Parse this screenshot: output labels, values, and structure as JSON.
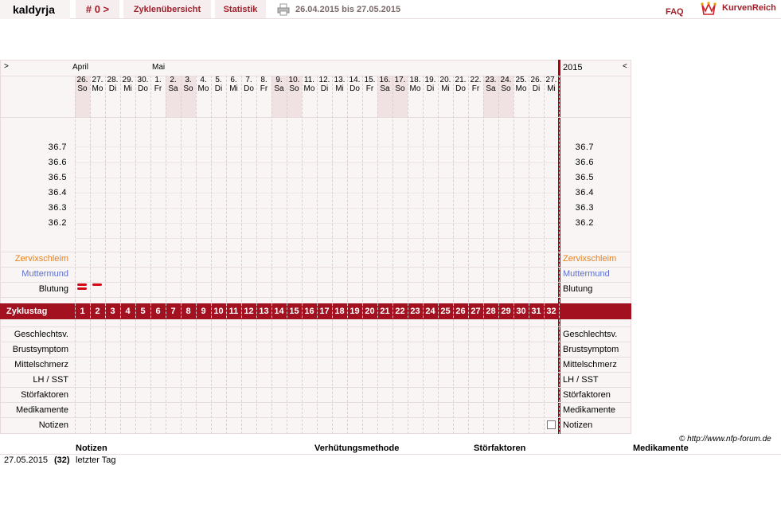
{
  "header": {
    "brand": "kaldyrja",
    "cycle_nav": "# 0 >",
    "tab_overview": "Zyklenübersicht",
    "tab_stats": "Statistik",
    "date_range": "26.04.2015 bis 27.05.2015",
    "faq": "FAQ",
    "logo_text": "KurvenReich",
    "accent": "#a0202a"
  },
  "chart": {
    "nav_left": ">",
    "nav_right": "<",
    "year": "2015",
    "months": [
      "April",
      "Mai"
    ],
    "dates": [
      "26.",
      "27.",
      "28.",
      "29.",
      "30.",
      "1.",
      "2.",
      "3.",
      "4.",
      "5.",
      "6.",
      "7.",
      "8.",
      "9.",
      "10.",
      "11.",
      "12.",
      "13.",
      "14.",
      "15.",
      "16.",
      "17.",
      "18.",
      "19.",
      "20.",
      "21.",
      "22.",
      "23.",
      "24.",
      "25.",
      "26.",
      "27."
    ],
    "weekdays": [
      "So",
      "Mo",
      "Di",
      "Mi",
      "Do",
      "Fr",
      "Sa",
      "So",
      "Mo",
      "Di",
      "Mi",
      "Do",
      "Fr",
      "Sa",
      "So",
      "Mo",
      "Di",
      "Mi",
      "Do",
      "Fr",
      "Sa",
      "So",
      "Mo",
      "Di",
      "Mi",
      "Do",
      "Fr",
      "Sa",
      "So",
      "Mo",
      "Di",
      "Mi"
    ],
    "temps": [
      "36.7",
      "36.6",
      "36.5",
      "36.4",
      "36.3",
      "36.2"
    ],
    "rows_top": [
      "Zervixschleim",
      "Muttermund",
      "Blutung"
    ],
    "zyklus_label": "Zyklustag",
    "cycle_days": [
      "1",
      "2",
      "3",
      "4",
      "5",
      "6",
      "7",
      "8",
      "9",
      "10",
      "11",
      "12",
      "13",
      "14",
      "15",
      "16",
      "17",
      "18",
      "19",
      "20",
      "21",
      "22",
      "23",
      "24",
      "25",
      "26",
      "27",
      "28",
      "29",
      "30",
      "31",
      "32"
    ],
    "rows_bottom": [
      "Geschlechtsv.",
      "Brustsymptom",
      "Mittelschmerz",
      "LH / SST",
      "Störfaktoren",
      "Medikamente",
      "Notizen"
    ],
    "bleeding_days": [
      1,
      2
    ],
    "colors": {
      "zervix": "#e8801a",
      "muttermund": "#5a6fd0",
      "bar": "#a3101f"
    }
  },
  "footer": {
    "copyright": "© http://www.nfp-forum.de",
    "cols": [
      "Notizen",
      "Verhütungsmethode",
      "Störfaktoren",
      "Medikamente"
    ],
    "note_date": "27.05.2015",
    "note_day": "(32)",
    "note_text": "letzter Tag"
  }
}
